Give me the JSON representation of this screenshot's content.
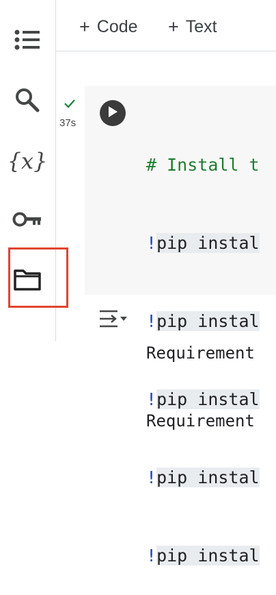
{
  "toolbar": {
    "add_code_label": "Code",
    "add_text_label": "Text"
  },
  "sidebar": {
    "items": [
      {
        "name": "table-of-contents",
        "icon": "list-icon"
      },
      {
        "name": "find",
        "icon": "search-icon"
      },
      {
        "name": "variables",
        "icon": "variables-icon",
        "glyph": "{x}"
      },
      {
        "name": "secrets",
        "icon": "key-icon"
      },
      {
        "name": "files",
        "icon": "folder-icon",
        "highlighted": true
      }
    ]
  },
  "cell": {
    "status_icon": "check-icon",
    "exec_time": "37s",
    "code_lines": [
      {
        "prefix": "# ",
        "text": "Install t",
        "type": "comment"
      },
      {
        "prefix": "!",
        "text": "pip instal",
        "type": "command"
      },
      {
        "prefix": "!",
        "text": "pip instal",
        "type": "command"
      },
      {
        "prefix": "!",
        "text": "pip instal",
        "type": "command"
      },
      {
        "prefix": "!",
        "text": "pip instal",
        "type": "command"
      },
      {
        "prefix": "!",
        "text": "pip instal",
        "type": "command"
      }
    ]
  },
  "output": {
    "lines": [
      "Requirement",
      "Requirement"
    ]
  },
  "colors": {
    "highlight_border": "#e0442f",
    "comment": "#1e7d2f",
    "bang": "#1a46c8"
  }
}
